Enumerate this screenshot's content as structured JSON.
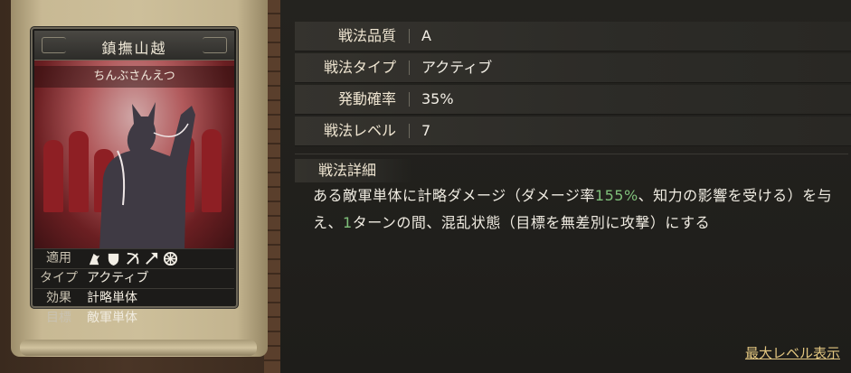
{
  "card": {
    "title": "鎮撫山越",
    "reading": "ちんぶさんえつ",
    "stats": [
      {
        "key": "適用",
        "value": ""
      },
      {
        "key": "タイプ",
        "value": "アクティブ"
      },
      {
        "key": "効果",
        "value": "計略単体"
      },
      {
        "key": "目標",
        "value": "敵軍単体"
      }
    ],
    "troop_icons": [
      "cavalry-icon",
      "shield-icon",
      "bow-icon",
      "spear-icon",
      "wheel-icon"
    ]
  },
  "attributes": [
    {
      "key": "戦法品質",
      "value": "A"
    },
    {
      "key": "戦法タイプ",
      "value": "アクティブ"
    },
    {
      "key": "発動確率",
      "value": "35%"
    },
    {
      "key": "戦法レベル",
      "value": "7"
    }
  ],
  "detail": {
    "heading": "戦法詳細",
    "text_1": "ある敵軍単体に計略ダメージ（ダメージ率",
    "rate": "155%",
    "text_2": "、知力の影響を受ける）を与え、",
    "turns": "1",
    "text_3": "ターンの間、混乱状態（目標を無差別に攻撃）にする"
  },
  "max_level_link": "最大レベル表示",
  "colors": {
    "highlight": "#7fc07a",
    "link": "#e2c680",
    "art_red": "#8e1f24"
  }
}
